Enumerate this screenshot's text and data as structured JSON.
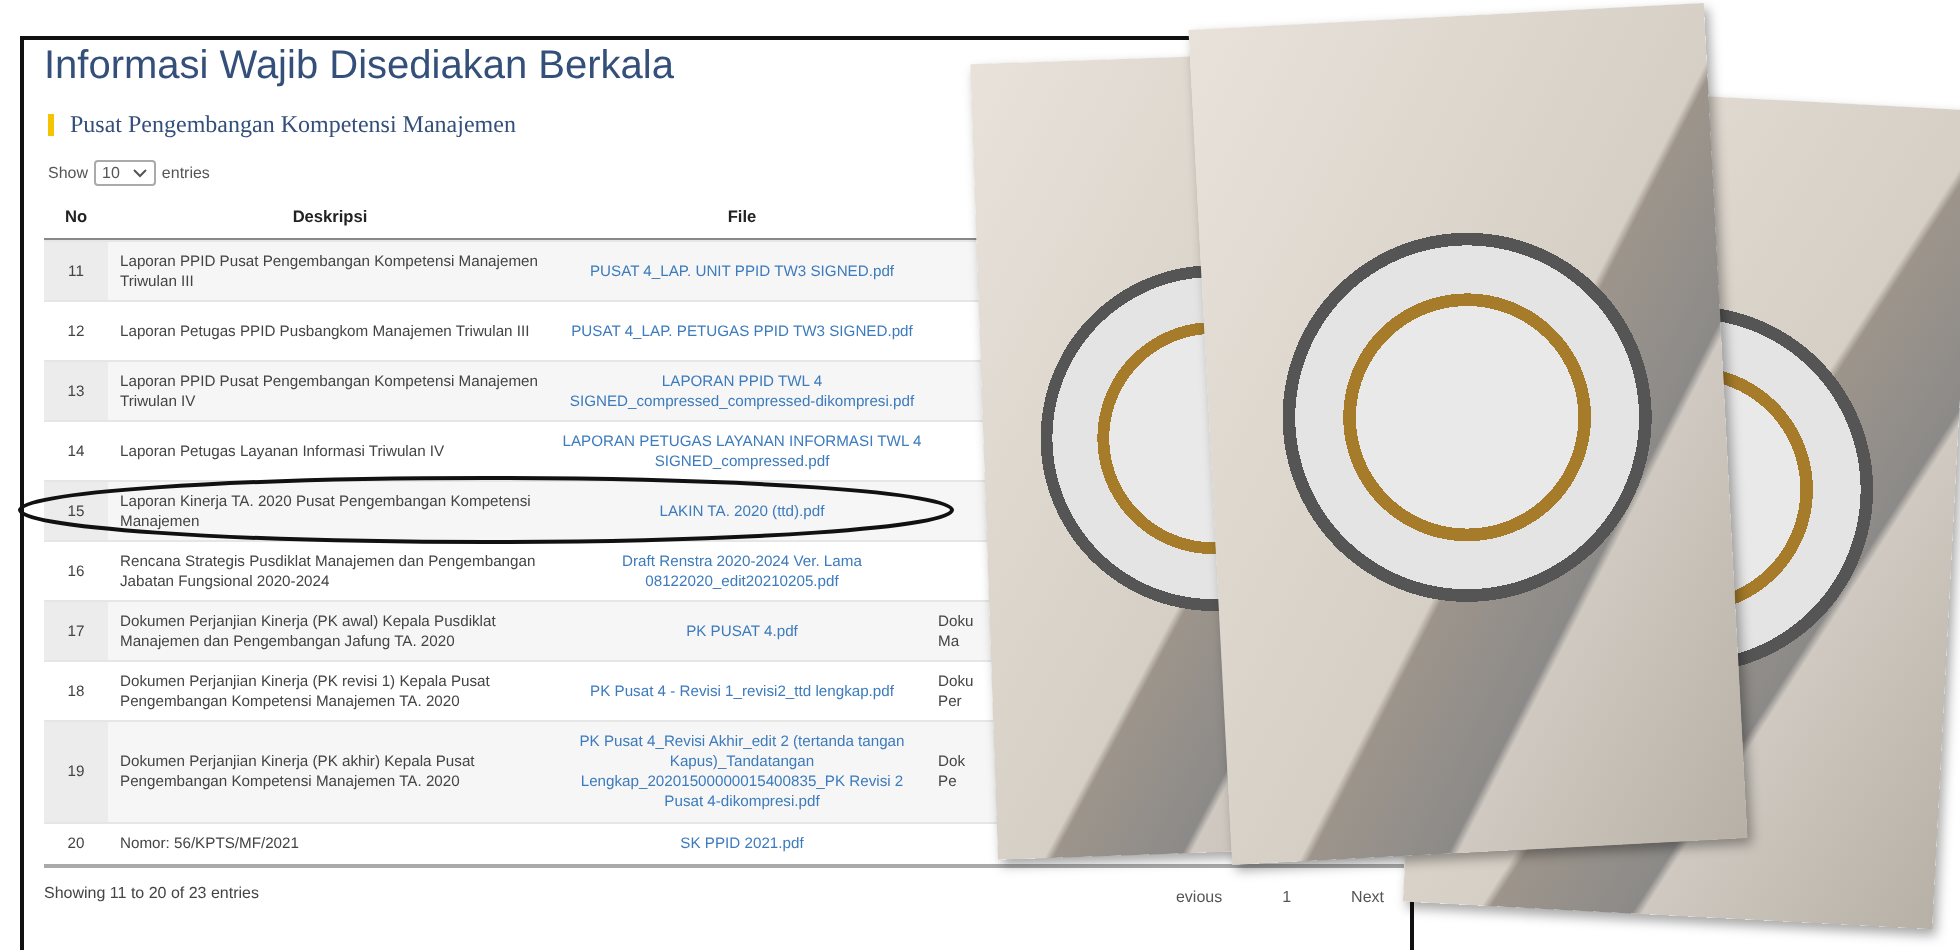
{
  "page": {
    "title": "Informasi Wajib Disediakan Berkala",
    "section": "Pusat Pengembangan Kompetensi Manajemen"
  },
  "length_control": {
    "prefix": "Show",
    "value": "10",
    "suffix": "entries"
  },
  "table": {
    "columns": [
      "No",
      "Deskripsi",
      "File"
    ],
    "rows": [
      {
        "no": "11",
        "description": "Laporan PPID Pusat Pengembangan Kompetensi Manajemen Triwulan III",
        "file": "PUSAT 4_LAP. UNIT PPID TW3 SIGNED.pdf",
        "circled": false
      },
      {
        "no": "12",
        "description": "Laporan Petugas PPID Pusbangkom Manajemen Triwulan III",
        "file": "PUSAT 4_LAP. PETUGAS PPID TW3 SIGNED.pdf",
        "circled": false
      },
      {
        "no": "13",
        "description": "Laporan PPID Pusat Pengembangan Kompetensi Manajemen Triwulan IV",
        "file": "LAPORAN PPID TWL 4 SIGNED_compressed_compressed-dikompresi.pdf",
        "circled": false
      },
      {
        "no": "14",
        "description": "Laporan Petugas Layanan Informasi Triwulan IV",
        "file": "LAPORAN PETUGAS LAYANAN INFORMASI TWL 4 SIGNED_compressed.pdf",
        "circled": false
      },
      {
        "no": "15",
        "description": "Laporan Kinerja TA. 2020 Pusat Pengembangan Kompetensi Manajemen",
        "file": "LAKIN TA. 2020 (ttd).pdf",
        "circled": true
      },
      {
        "no": "16",
        "description": "Rencana Strategis Pusdiklat Manajemen dan Pengembangan Jabatan Fungsional 2020-2024",
        "file": "Draft Renstra 2020-2024 Ver. Lama 08122020_edit20210205.pdf",
        "circled": false
      },
      {
        "no": "17",
        "description": "Dokumen Perjanjian Kinerja (PK awal) Kepala Pusdiklat Manajemen dan Pengembangan Jafung TA. 2020",
        "file": "PK PUSAT 4.pdf",
        "column_3": "Doku\nMa",
        "circled": false
      },
      {
        "no": "18",
        "description": "Dokumen Perjanjian Kinerja (PK revisi 1) Kepala Pusat Pengembangan Kompetensi Manajemen TA. 2020",
        "file": "PK Pusat 4 - Revisi 1_revisi2_ttd lengkap.pdf",
        "column_3": "Doku\nPer",
        "circled": false
      },
      {
        "no": "19",
        "description": "Dokumen Perjanjian Kinerja (PK akhir) Kepala Pusat Pengembangan Kompetensi Manajemen TA. 2020",
        "file": "PK Pusat 4_Revisi Akhir_edit 2 (tertanda tangan Kapus)_Tandatangan Lengkap_20201500000015400835_PK Revisi 2 Pusat 4-dikompresi.pdf",
        "column_3": "Dok\nPe",
        "circled": false
      },
      {
        "no": "20",
        "description": "Nomor: 56/KPTS/MF/2021",
        "file": "SK PPID 2021.pdf",
        "circled": false
      }
    ]
  },
  "info": "Showing 11 to 20 of 23 entries",
  "pagination": [
    "evious",
    "1",
    "Next"
  ]
}
